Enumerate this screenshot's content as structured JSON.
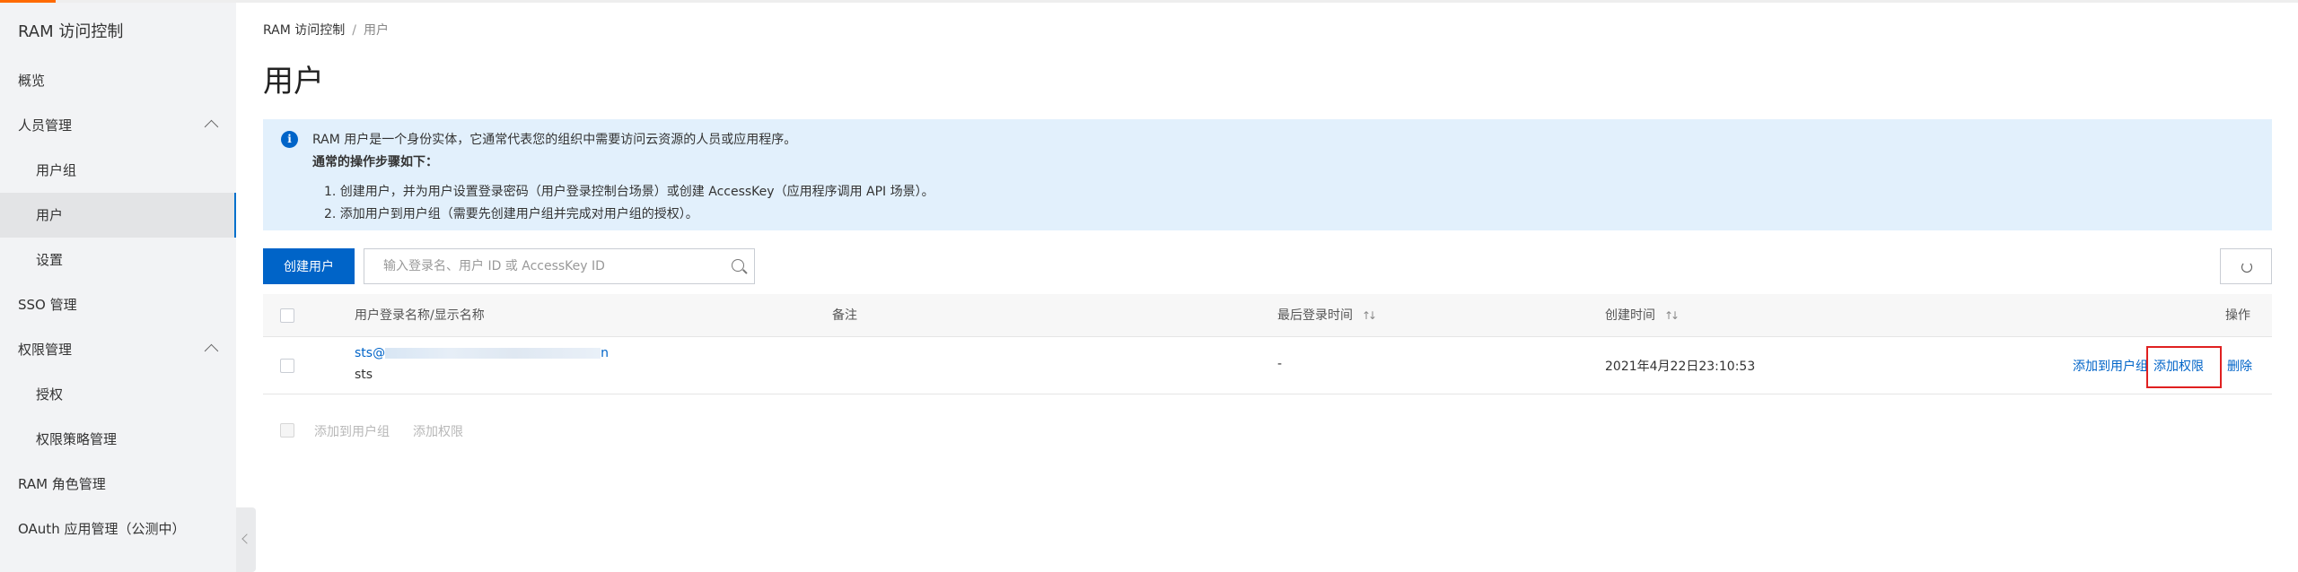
{
  "sidebar": {
    "title": "RAM 访问控制",
    "items": [
      {
        "label": "概览"
      },
      {
        "label": "人员管理"
      },
      {
        "label": "用户组"
      },
      {
        "label": "用户"
      },
      {
        "label": "设置"
      },
      {
        "label": "SSO 管理"
      },
      {
        "label": "权限管理"
      },
      {
        "label": "授权"
      },
      {
        "label": "权限策略管理"
      },
      {
        "label": "RAM 角色管理"
      },
      {
        "label": "OAuth 应用管理（公测中）"
      }
    ]
  },
  "breadcrumb": {
    "root": "RAM 访问控制",
    "separator": "/",
    "current": "用户"
  },
  "page": {
    "title": "用户"
  },
  "notice": {
    "intro": "RAM 用户是一个身份实体，它通常代表您的组织中需要访问云资源的人员或应用程序。",
    "steps_title": "通常的操作步骤如下：",
    "step1": "1. 创建用户，并为用户设置登录密码（用户登录控制台场景）或创建 AccessKey（应用程序调用 API 场景）。",
    "step2": "2. 添加用户到用户组（需要先创建用户组并完成对用户组的授权）。"
  },
  "toolbar": {
    "create_label": "创建用户",
    "search_placeholder": "输入登录名、用户 ID 或 AccessKey ID"
  },
  "table": {
    "columns": {
      "name": "用户登录名称/显示名称",
      "note": "备注",
      "last_login": "最后登录时间",
      "created": "创建时间",
      "actions": "操作"
    },
    "sort_glyph": "↑↓",
    "rows": [
      {
        "login_prefix": "sts@",
        "login_suffix": "n",
        "display_name": "sts",
        "note": "",
        "last_login": "-",
        "created": "2021年4月22日23:10:53",
        "action_add_group": "添加到用户组",
        "action_add_permission": "添加权限",
        "action_delete": "删除"
      }
    ]
  },
  "batch": {
    "add_group": "添加到用户组",
    "add_permission": "添加权限"
  },
  "colors": {
    "primary": "#0064c8",
    "accent": "#ff6a00",
    "highlight": "#e02020",
    "notice_bg": "#e2f0fc"
  }
}
